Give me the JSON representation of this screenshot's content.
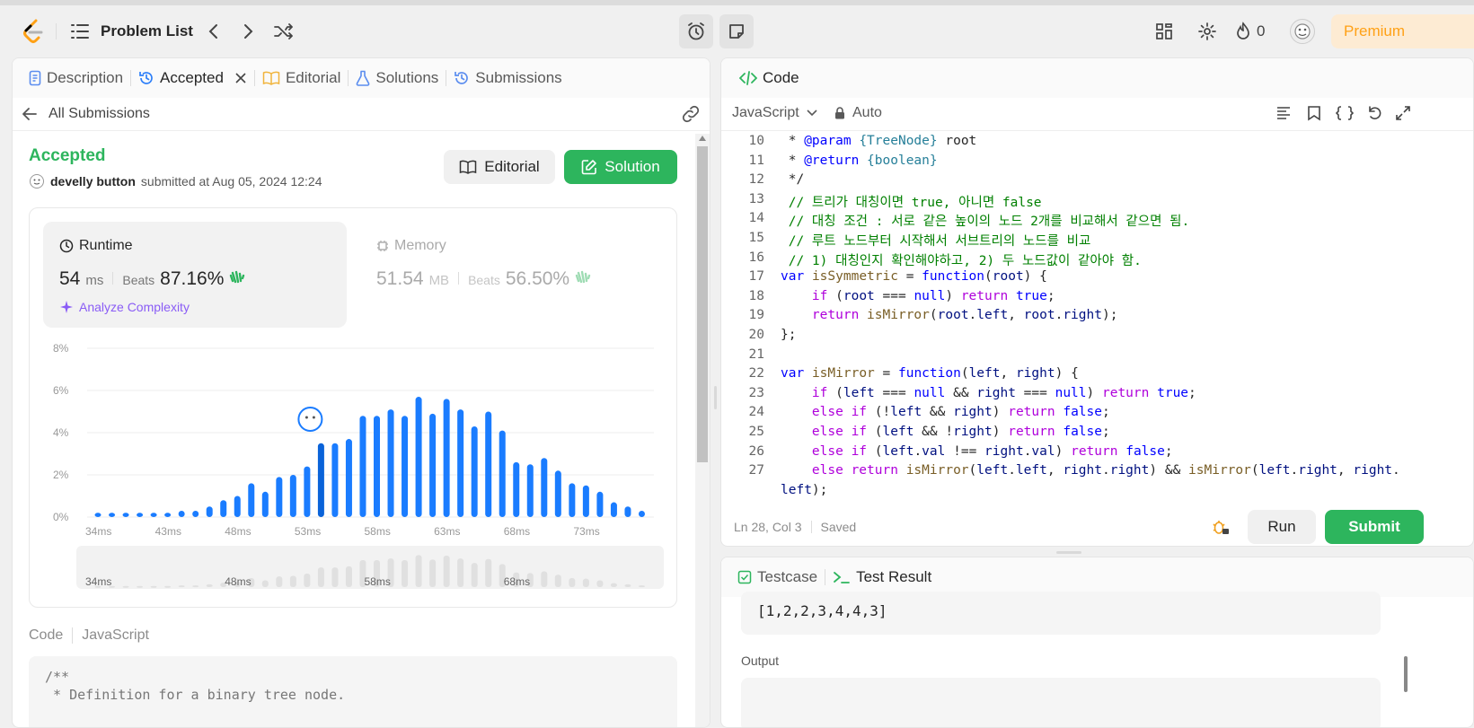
{
  "topbar": {
    "problem_list": "Problem List",
    "streak": "0",
    "premium": "Premium"
  },
  "left": {
    "tabs": [
      {
        "label": "Description"
      },
      {
        "label": "Accepted"
      },
      {
        "label": "Editorial"
      },
      {
        "label": "Solutions"
      },
      {
        "label": "Submissions"
      }
    ],
    "back_label": "All Submissions",
    "status": "Accepted",
    "user": "develly button",
    "submitted_text": "submitted at Aug 05, 2024 12:24",
    "editorial_btn": "Editorial",
    "solution_btn": "Solution",
    "runtime": {
      "title": "Runtime",
      "value": "54",
      "unit": "ms",
      "beats_label": "Beats",
      "beats": "87.16%",
      "analyze": "Analyze Complexity"
    },
    "memory": {
      "title": "Memory",
      "value": "51.54",
      "unit": "MB",
      "beats_label": "Beats",
      "beats": "56.50%"
    },
    "code_label": "Code",
    "code_lang": "JavaScript",
    "code_preview": [
      "/**",
      " * Definition for a binary tree node."
    ]
  },
  "chart_data": {
    "type": "bar",
    "ylabel_ticks": [
      "8%",
      "6%",
      "4%",
      "2%",
      "0%"
    ],
    "ylim": [
      0,
      8
    ],
    "x_tick_labels": [
      "34ms",
      "43ms",
      "48ms",
      "53ms",
      "58ms",
      "63ms",
      "68ms",
      "73ms"
    ],
    "mini_tick_labels": [
      "34ms",
      "48ms",
      "58ms",
      "68ms"
    ],
    "values": [
      0.2,
      0.2,
      0.2,
      0.2,
      0.2,
      0.2,
      0.3,
      0.3,
      0.5,
      0.8,
      1.0,
      1.6,
      1.2,
      1.9,
      2.0,
      2.4,
      3.5,
      3.5,
      3.7,
      4.8,
      4.8,
      5.1,
      4.8,
      5.7,
      4.9,
      5.6,
      5.1,
      4.3,
      5.0,
      4.1,
      2.6,
      2.5,
      2.8,
      2.2,
      1.6,
      1.5,
      1.2,
      0.7,
      0.5,
      0.3
    ],
    "highlight_index": 16,
    "grid": true,
    "colors": {
      "bar": "#1a7cff",
      "highlight": "#0a63d9",
      "mini_bar": "#e0e0e0"
    }
  },
  "right": {
    "code_title": "Code",
    "language": "JavaScript",
    "auto": "Auto",
    "status_bar": {
      "position": "Ln 28, Col 3",
      "saved": "Saved"
    },
    "run_btn": "Run",
    "submit_btn": "Submit",
    "bottom_tabs": [
      {
        "label": "Testcase"
      },
      {
        "label": "Test Result"
      }
    ],
    "testcase_value": "[1,2,2,3,4,4,3]",
    "output_label": "Output",
    "code_lines": [
      {
        "n": "10",
        "text": " * @param {TreeNode} root"
      },
      {
        "n": "11",
        "text": " * @return {boolean}"
      },
      {
        "n": "12",
        "text": " */"
      },
      {
        "n": "13",
        "text": " // 트리가 대칭이면 true, 아니면 false"
      },
      {
        "n": "14",
        "text": " // 대칭 조건 : 서로 같은 높이의 노드 2개를 비교해서 같으면 됨."
      },
      {
        "n": "15",
        "text": " // 루트 노드부터 시작해서 서브트리의 노드를 비교"
      },
      {
        "n": "16",
        "text": " // 1) 대칭인지 확인해야하고, 2) 두 노드값이 같아야 함."
      },
      {
        "n": "17",
        "text": "var isSymmetric = function(root) {"
      },
      {
        "n": "18",
        "text": "    if (root === null) return true;"
      },
      {
        "n": "19",
        "text": "    return isMirror(root.left, root.right);"
      },
      {
        "n": "20",
        "text": "};"
      },
      {
        "n": "21",
        "text": ""
      },
      {
        "n": "22",
        "text": "var isMirror = function(left, right) {"
      },
      {
        "n": "23",
        "text": "    if (left === null && right === null) return true;"
      },
      {
        "n": "24",
        "text": "    else if (!left && right) return false;"
      },
      {
        "n": "25",
        "text": "    else if (left && !right) return false;"
      },
      {
        "n": "26",
        "text": "    else if (left.val !== right.val) return false;"
      },
      {
        "n": "27",
        "text": "    else return isMirror(left.left, right.right) && isMirror(left.right, right."
      },
      {
        "n": "",
        "text": "left);"
      }
    ]
  }
}
